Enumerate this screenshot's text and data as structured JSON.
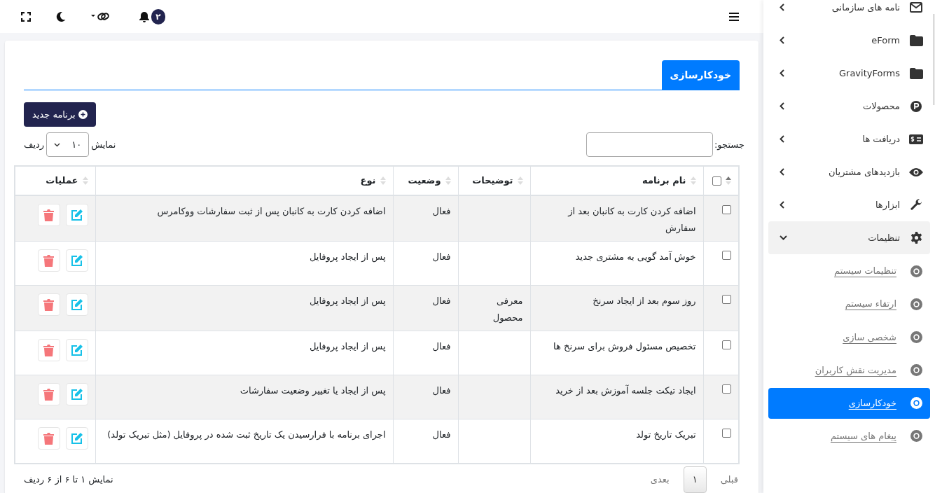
{
  "topbar": {
    "notifications": "۲"
  },
  "page_tab": {
    "label": "خودکارسازی",
    "selected": true
  },
  "new_button": "برنامه جدید",
  "search": {
    "label": "جستجو:"
  },
  "page_size": {
    "before": "نمایش",
    "value": "۱۰",
    "after": "ردیف"
  },
  "table": {
    "columns": [
      {
        "kind": "checkbox",
        "sorted": true,
        "checked": false
      },
      {
        "kind": "text",
        "label": "نام برنامه",
        "sorted": false
      },
      {
        "kind": "text",
        "label": "توضیحات",
        "sorted": false
      },
      {
        "kind": "text",
        "label": "وضعیت",
        "sorted": false
      },
      {
        "kind": "text",
        "label": "نوع",
        "sorted": false
      },
      {
        "kind": "text",
        "label": "عملیات",
        "sorted": false
      }
    ],
    "rows": [
      {
        "checked": false,
        "name": "اضافه کردن کارت به کانبان بعد از سفارش",
        "description": "",
        "status": "فعال",
        "type": "اضافه کردن کارت به کانبان پس از ثبت سفارشات ووکامرس"
      },
      {
        "checked": false,
        "name": "خوش آمد گویی به مشتری جدید",
        "description": "",
        "status": "فعال",
        "type": "پس از ایجاد پروفایل"
      },
      {
        "checked": false,
        "name": "روز سوم بعد از ایجاد سرنخ",
        "description": "معرفی محصول",
        "status": "فعال",
        "type": "پس از ایجاد پروفایل"
      },
      {
        "checked": false,
        "name": "تخصیص مسئول فروش برای سرنخ ها",
        "description": "",
        "status": "فعال",
        "type": "پس از ایجاد پروفایل"
      },
      {
        "checked": false,
        "name": "ایجاد تیکت جلسه آموزش بعد از خرید",
        "description": "",
        "status": "فعال",
        "type": "پس از ایجاد یا تغییر وضعیت سفارشات"
      },
      {
        "checked": false,
        "name": "تبریک تاریخ تولد",
        "description": "",
        "status": "فعال",
        "type": "اجرای برنامه با فرارسیدن یک تاریخ ثبت شده در پروفایل (مثل تبریک تولد)"
      }
    ]
  },
  "footer": {
    "info": "نمایش ۱ تا ۶ از ۶ ردیف",
    "prev": "قبلی",
    "page": "۱",
    "next": "بعدی"
  },
  "sidebar": {
    "items": [
      {
        "label": "نامه های سازمانی",
        "expanded": false
      },
      {
        "label": "eForm",
        "expanded": false
      },
      {
        "label": "GravityForms",
        "expanded": false
      },
      {
        "label": "محصولات",
        "expanded": false
      },
      {
        "label": "دریافت ها",
        "expanded": false
      },
      {
        "label": "بازدیدهای مشتریان",
        "expanded": false
      },
      {
        "label": "ابزارها",
        "expanded": false
      },
      {
        "label": "تنظیمات",
        "expanded": true,
        "children": [
          {
            "label": "تنظیمات سیستم",
            "selected": false
          },
          {
            "label": "ارتقاء سیستم",
            "selected": false
          },
          {
            "label": "شخصی سازی",
            "selected": false
          },
          {
            "label": "مدیریت نقش کاربران",
            "selected": false
          },
          {
            "label": "خودکارسازی",
            "selected": true
          },
          {
            "label": "پیغام های سیستم",
            "selected": false
          }
        ]
      }
    ]
  }
}
